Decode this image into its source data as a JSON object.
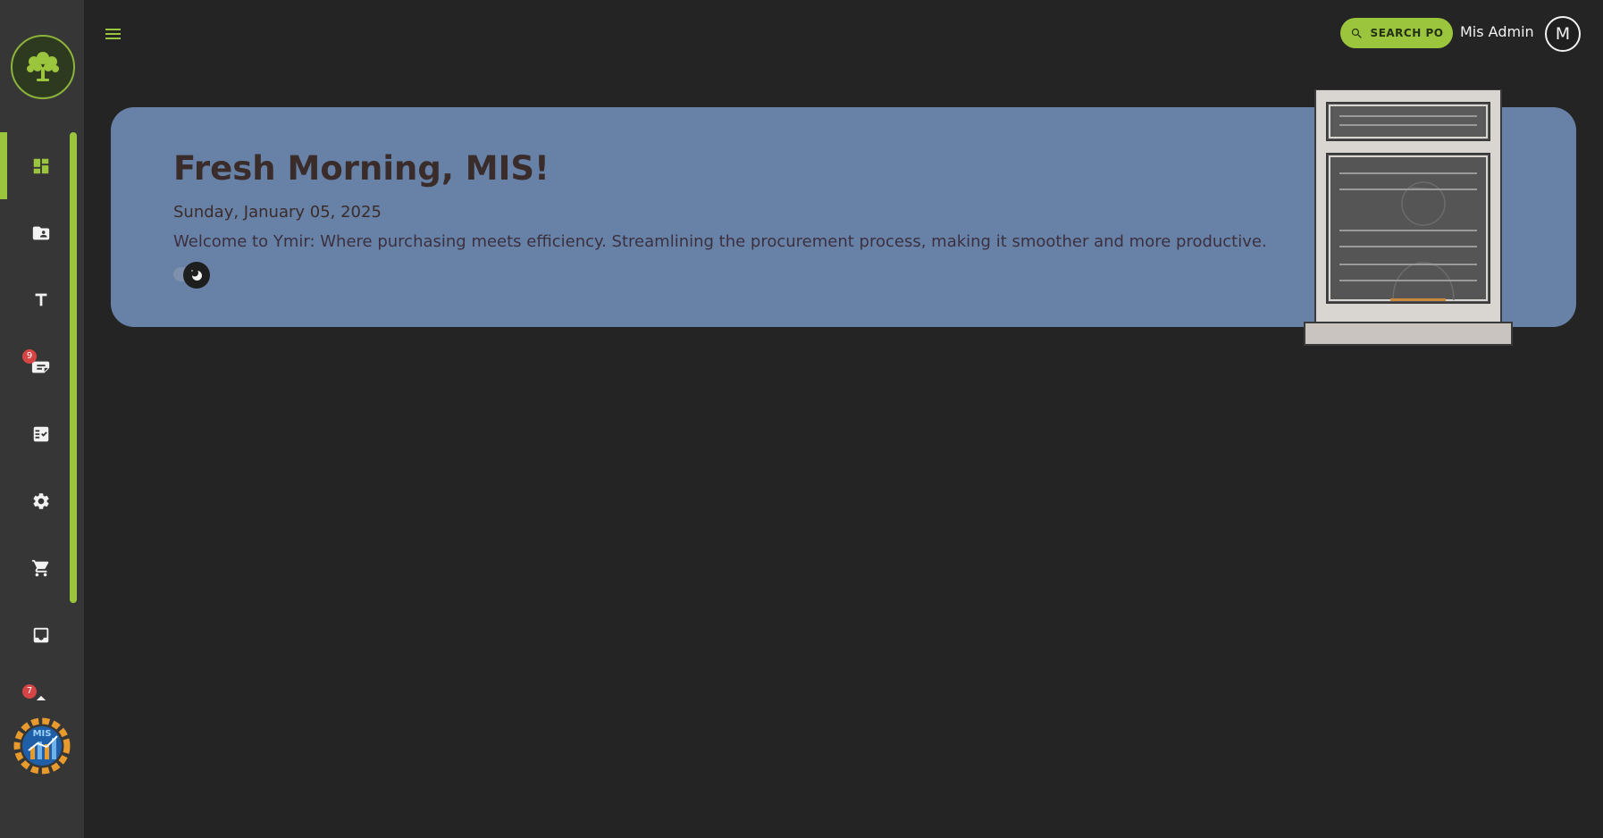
{
  "header": {
    "search_label": "SEARCH PO",
    "user_name": "Mis Admin",
    "avatar_initial": "M"
  },
  "hero": {
    "greeting": "Fresh Morning, MIS!",
    "date": "Sunday, January 05, 2025",
    "welcome": "Welcome to Ymir: Where purchasing meets efficiency. Streamlining the procurement process, making it smoother and more productive."
  },
  "sidebar": {
    "items": [
      {
        "icon": "dashboard-icon",
        "active": true
      },
      {
        "icon": "folder-account-icon"
      },
      {
        "icon": "text-t-icon"
      },
      {
        "icon": "notes-icon",
        "badge": "9"
      },
      {
        "icon": "checklist-icon"
      },
      {
        "icon": "gear-icon"
      },
      {
        "icon": "cart-icon"
      },
      {
        "icon": "inbox-icon"
      },
      {
        "icon": "partial-icon",
        "badge": "7"
      }
    ],
    "footer_logo_text": "MIS"
  },
  "colors": {
    "accent": "#9bc53d",
    "hero_bg": "#6882a7",
    "page_bg": "#242424",
    "sidebar_bg": "#363636",
    "badge": "#d64545"
  }
}
